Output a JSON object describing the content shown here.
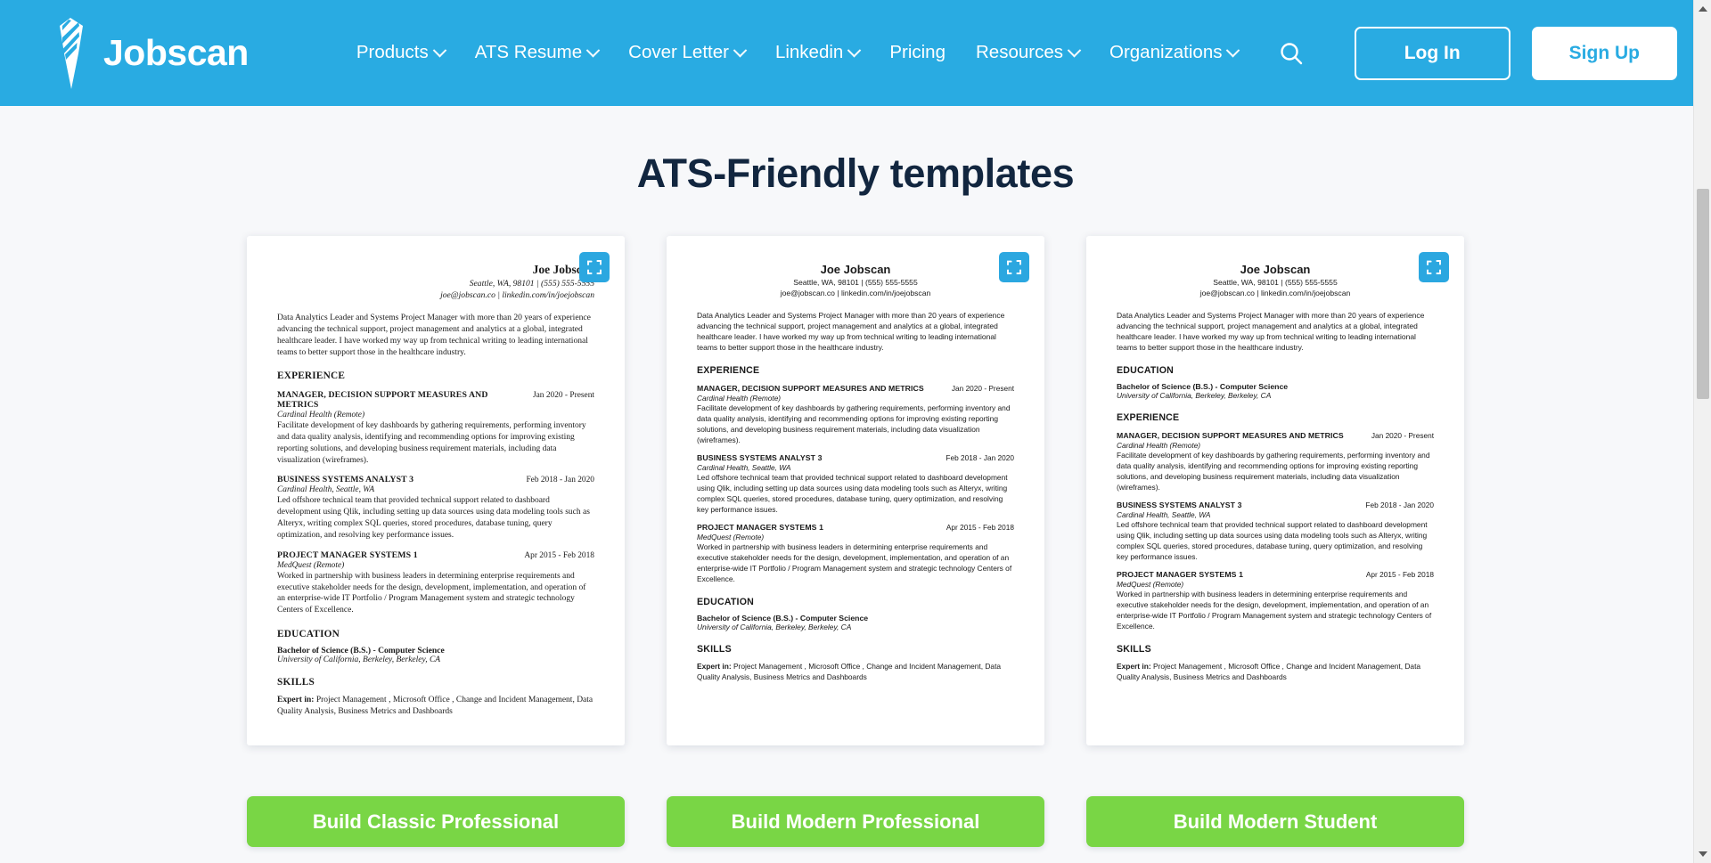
{
  "theme": {
    "brand_blue": "#29abe2",
    "accent_green": "#79d645",
    "title_navy": "#12263f",
    "page_bg": "#f7f8fa"
  },
  "header": {
    "brand_name": "Jobscan",
    "logo_icon": "jobscan-tie-logo",
    "search_icon": "search-icon",
    "nav": [
      {
        "label": "Products",
        "has_dropdown": true
      },
      {
        "label": "ATS Resume",
        "has_dropdown": true
      },
      {
        "label": "Cover Letter",
        "has_dropdown": true
      },
      {
        "label": "Linkedin",
        "has_dropdown": true
      },
      {
        "label": "Pricing",
        "has_dropdown": false
      },
      {
        "label": "Resources",
        "has_dropdown": true
      },
      {
        "label": "Organizations",
        "has_dropdown": true
      }
    ],
    "login_label": "Log In",
    "signup_label": "Sign Up"
  },
  "main": {
    "page_title": "ATS-Friendly templates",
    "expand_icon": "expand-fullscreen-icon"
  },
  "resume_common": {
    "name": "Joe Jobscan",
    "contact_line1": "Seattle, WA, 98101 | (555) 555-5555",
    "contact_line2": "joe@jobscan.co | linkedin.com/in/joejobscan",
    "summary": "Data Analytics Leader and Systems Project Manager with more than 20 years of experience advancing the technical support, project management and analytics at a global, integrated healthcare leader. I have worked my way up from technical writing to leading international teams to better support those in the healthcare industry.",
    "experience_heading": "EXPERIENCE",
    "education_heading": "EDUCATION",
    "skills_heading": "SKILLS",
    "jobs": [
      {
        "title": "MANAGER, DECISION SUPPORT MEASURES AND METRICS",
        "date": "Jan 2020 - Present",
        "company": "Cardinal Health (Remote)",
        "desc": "Facilitate development of key dashboards by gathering requirements, performing inventory and data quality analysis, identifying and recommending options for improving existing reporting solutions, and developing business requirement materials, including data visualization (wireframes)."
      },
      {
        "title": "BUSINESS SYSTEMS ANALYST 3",
        "date": "Feb 2018 - Jan 2020",
        "company": "Cardinal Health, Seattle, WA",
        "desc": "Led offshore technical team that provided technical support related to dashboard development using Qlik, including setting up data sources using data modeling tools such as Alteryx, writing complex SQL queries, stored procedures, database tuning, query optimization, and resolving key performance issues."
      },
      {
        "title": "PROJECT MANAGER SYSTEMS 1",
        "date": "Apr 2015 - Feb 2018",
        "company": "MedQuest (Remote)",
        "desc": "Worked in partnership with business leaders in determining enterprise requirements and executive stakeholder needs for the design, development, implementation, and operation of an enterprise-wide IT Portfolio / Program Management system and strategic technology Centers of Excellence."
      }
    ],
    "degree": "Bachelor of Science (B.S.) - Computer Science",
    "school": "University of California, Berkeley, Berkeley, CA",
    "skills_label": "Expert in:",
    "skills_text": " Project Management , Microsoft Office , Change and Incident Management, Data Quality Analysis, Business Metrics and Dashboards"
  },
  "templates": [
    {
      "style": "serif",
      "order": "experience-first",
      "build_label": "Build Classic Professional"
    },
    {
      "style": "sans",
      "order": "experience-first",
      "build_label": "Build Modern Professional"
    },
    {
      "style": "sans",
      "order": "education-first",
      "build_label": "Build Modern Student"
    }
  ],
  "scrollbar": {
    "up_icon": "scroll-up-arrow-icon",
    "down_icon": "scroll-down-arrow-icon"
  }
}
